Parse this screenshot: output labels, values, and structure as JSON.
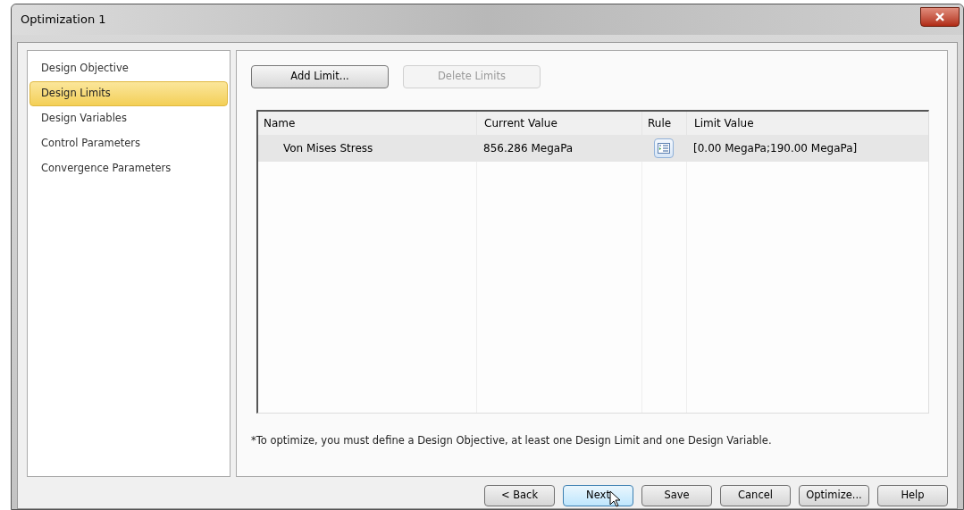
{
  "window": {
    "title": "Optimization 1"
  },
  "sidebar": {
    "items": [
      {
        "label": "Design Objective",
        "selected": false
      },
      {
        "label": "Design Limits",
        "selected": true
      },
      {
        "label": "Design Variables",
        "selected": false
      },
      {
        "label": "Control Parameters",
        "selected": false
      },
      {
        "label": "Convergence Parameters",
        "selected": false
      }
    ]
  },
  "toolbar": [
    {
      "label": "Add Limit...",
      "disabled": false
    },
    {
      "label": "Delete Limits",
      "disabled": true
    }
  ],
  "table": {
    "columns": [
      "Name",
      "Current Value",
      "Rule",
      "Limit Value"
    ],
    "rows": [
      {
        "name": "Von Mises Stress",
        "current_value": "856.286 MegaPa",
        "limit_value": "[0.00 MegaPa;190.00 MegaPa]",
        "selected": true
      }
    ]
  },
  "note": "*To optimize, you must define a Design Objective, at least one Design Limit and one Design Variable.",
  "buttons": [
    {
      "label": "< Back",
      "hovered": false
    },
    {
      "label": "Next",
      "hovered": true
    },
    {
      "label": "Save",
      "hovered": false
    },
    {
      "label": "Cancel",
      "hovered": false
    },
    {
      "label": "Optimize...",
      "hovered": false
    },
    {
      "label": "Help",
      "hovered": false
    }
  ]
}
